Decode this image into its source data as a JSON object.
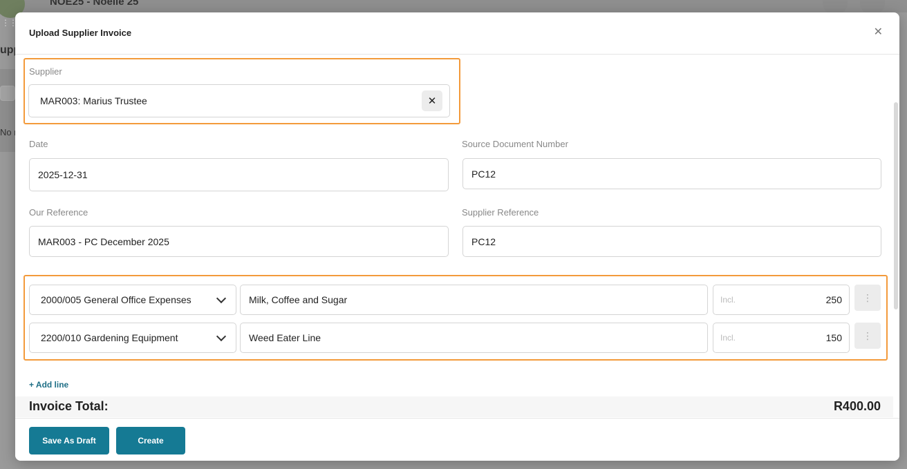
{
  "background": {
    "app_title": "NOE25 - Noelle 25",
    "side_text_1": "upp",
    "side_text_2": "No r"
  },
  "modal": {
    "title": "Upload Supplier Invoice",
    "close_glyph": "✕"
  },
  "supplier": {
    "label": "Supplier",
    "value": "MAR003: Marius Trustee",
    "clear_glyph": "✕"
  },
  "date": {
    "label": "Date",
    "value": "2025-12-31"
  },
  "source_document": {
    "label": "Source Document Number",
    "value": "PC12"
  },
  "our_reference": {
    "label": "Our Reference",
    "value": "MAR003 - PC December 2025"
  },
  "supplier_reference": {
    "label": "Supplier Reference",
    "value": "PC12"
  },
  "lines": [
    {
      "account": "2000/005 General Office Expenses",
      "description": "Milk, Coffee and Sugar",
      "amount_placeholder": "Incl.",
      "amount": "250"
    },
    {
      "account": "2200/010 Gardening Equipment",
      "description": "Weed Eater Line",
      "amount_placeholder": "Incl.",
      "amount": "150"
    }
  ],
  "add_line_label": "+ Add line",
  "invoice_total": {
    "label": "Invoice Total:",
    "value": "R400.00"
  },
  "footer": {
    "save_draft_label": "Save As Draft",
    "create_label": "Create"
  },
  "colors": {
    "primary_button": "#157a94",
    "highlight": "#f39a3a",
    "link": "#1f6f86"
  }
}
